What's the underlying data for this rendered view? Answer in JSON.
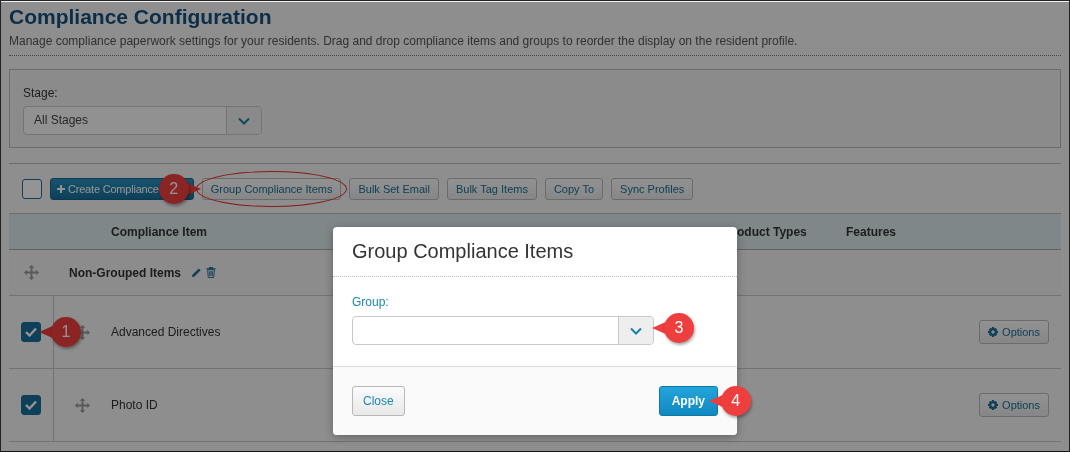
{
  "page": {
    "title": "Compliance Configuration",
    "subtitle": "Manage compliance paperwork settings for your residents. Drag and drop compliance items and groups to reorder the display on the resident profile."
  },
  "filter": {
    "label": "Stage:",
    "value": "All Stages"
  },
  "toolbar": {
    "select_all_checked": false,
    "buttons": [
      {
        "label": "Create Compliance",
        "kind": "primary",
        "highlighted": false
      },
      {
        "label": "Group Compliance Items",
        "kind": "default",
        "highlighted": true,
        "callout": "2"
      },
      {
        "label": "Bulk Set Email",
        "kind": "default",
        "highlighted": false
      },
      {
        "label": "Bulk Tag Items",
        "kind": "default",
        "highlighted": false
      },
      {
        "label": "Copy To",
        "kind": "default",
        "highlighted": false
      },
      {
        "label": "Sync Profiles",
        "kind": "default",
        "highlighted": false
      }
    ]
  },
  "table": {
    "columns": [
      "Compliance Item",
      "oduct Types",
      "Features"
    ],
    "groups": [
      {
        "name": "Non-Grouped Items",
        "rows": [
          {
            "name": "Advanced Directives",
            "checked": true,
            "callout": "1",
            "action": "Options"
          },
          {
            "name": "Photo ID",
            "checked": true,
            "action": "Options"
          }
        ]
      }
    ]
  },
  "modal": {
    "title": "Group Compliance Items",
    "field_label": "Group:",
    "field_callout": "3",
    "buttons": [
      {
        "label": "Close",
        "kind": "default"
      },
      {
        "label": "Apply",
        "kind": "primary",
        "callout": "4"
      }
    ]
  }
}
